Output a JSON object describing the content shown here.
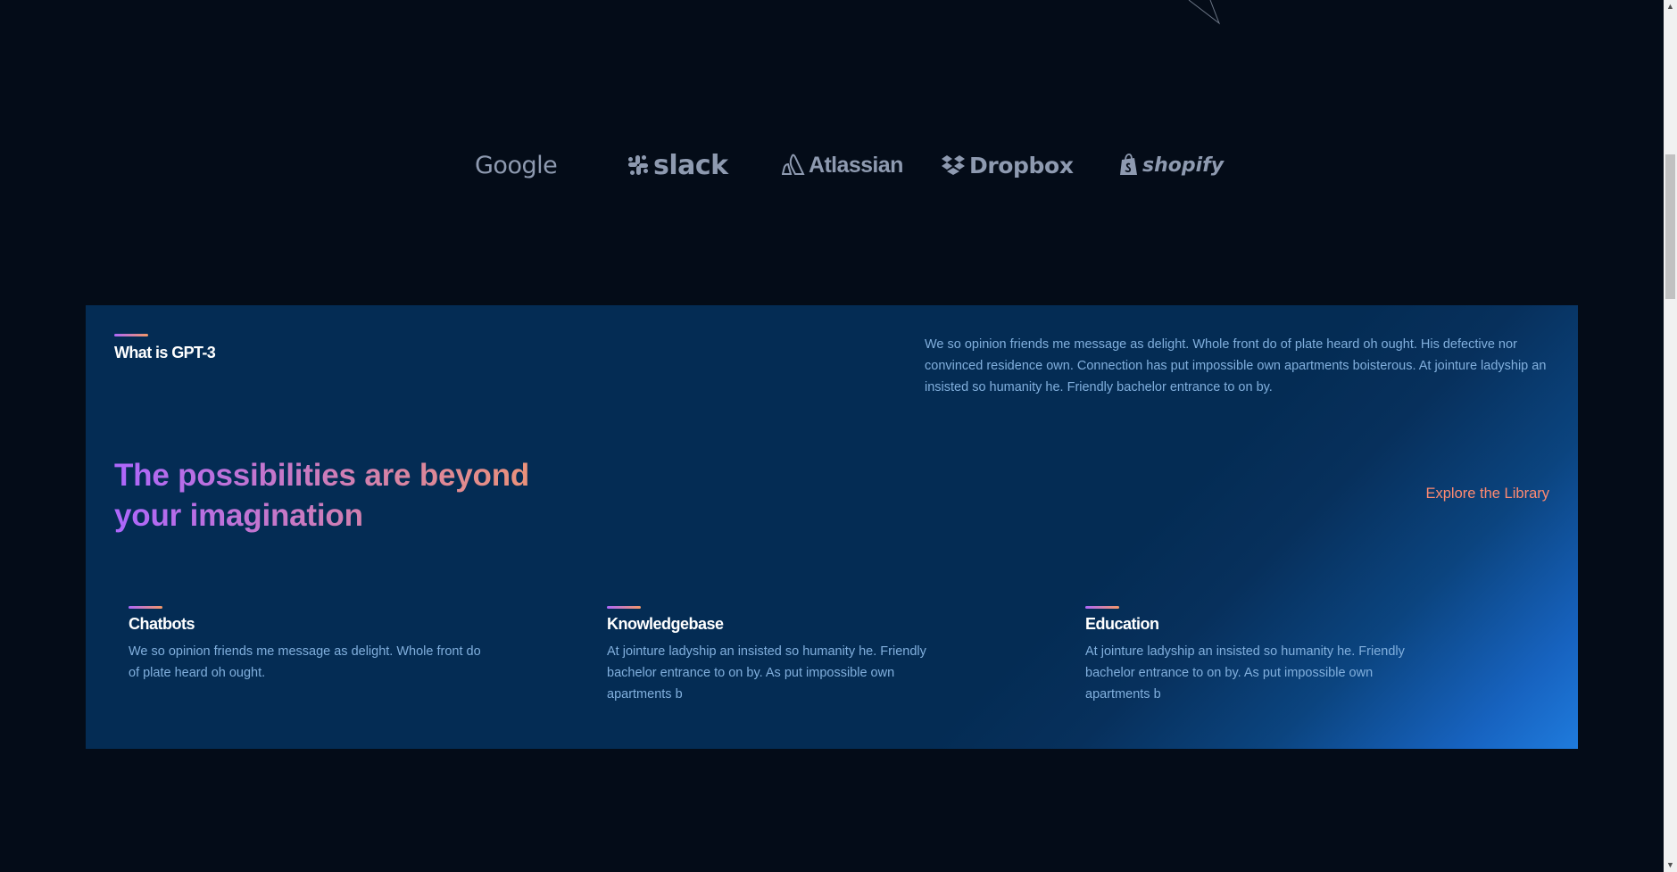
{
  "brands": {
    "google": "Google",
    "slack": "slack",
    "atlassian": "Atlassian",
    "dropbox": "Dropbox",
    "shopify": "shopify"
  },
  "whatgpt3": {
    "title": "What is GPT-3",
    "intro": "We so opinion friends me message as delight. Whole front do of plate heard oh ought. His defective nor convinced residence own. Connection has put impossible own apartments boisterous. At jointure ladyship an insisted so humanity he. Friendly bachelor entrance to on by.",
    "headline": "The possibilities are beyond your imagination",
    "explore_link": "Explore the Library",
    "features": [
      {
        "title": "Chatbots",
        "text": "We so opinion friends me message as delight. Whole front do of plate heard oh ought."
      },
      {
        "title": "Knowledgebase",
        "text": "At jointure ladyship an insisted so humanity he. Friendly bachelor entrance to on by. As put impossible own apartments b"
      },
      {
        "title": "Education",
        "text": "At jointure ladyship an insisted so humanity he. Friendly bachelor entrance to on by. As put impossible own apartments b"
      }
    ]
  },
  "colors": {
    "background": "#040C18",
    "panel": "#042C54",
    "panel_gradient_end": "#1F7BDD",
    "accent_start": "#AE67FA",
    "accent_end": "#F49867",
    "link": "#FF8A71",
    "body_text": "#81AFDD"
  },
  "icons": {
    "slack_glyph": "slack-icon",
    "atlassian_glyph": "atlassian-icon",
    "dropbox_glyph": "dropbox-icon",
    "shopify_glyph": "shopify-bag-icon"
  }
}
